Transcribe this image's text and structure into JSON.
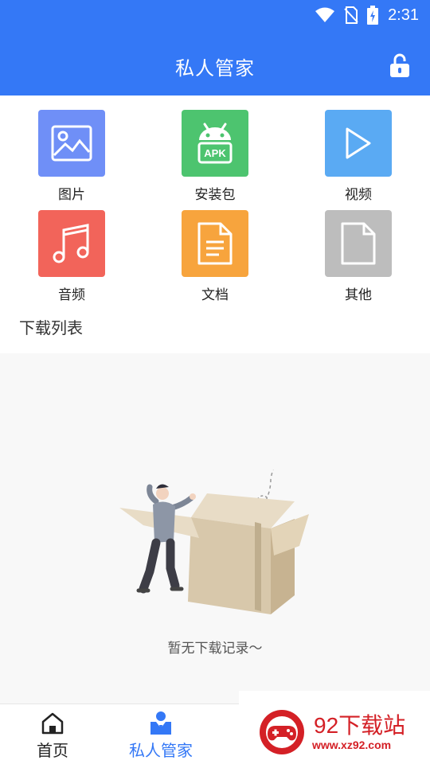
{
  "status_bar": {
    "time": "2:31"
  },
  "header": {
    "title": "私人管家"
  },
  "categories": [
    {
      "label": "图片",
      "icon": "image-icon",
      "color": "#6f8ff7"
    },
    {
      "label": "安装包",
      "icon": "apk-icon",
      "color": "#4dc46f"
    },
    {
      "label": "视频",
      "icon": "play-icon",
      "color": "#5aaaf3"
    },
    {
      "label": "音频",
      "icon": "music-icon",
      "color": "#f2645a"
    },
    {
      "label": "文档",
      "icon": "document-icon",
      "color": "#f7a43d"
    },
    {
      "label": "其他",
      "icon": "file-icon",
      "color": "#bdbdbd"
    }
  ],
  "apk_text": "APK",
  "downloads": {
    "section_title": "下载列表",
    "empty_text": "暂无下载记录～"
  },
  "tabbar": {
    "tabs": [
      {
        "label": "首页",
        "icon": "home-icon",
        "active": false
      },
      {
        "label": "私人管家",
        "icon": "butler-icon",
        "active": true
      }
    ],
    "active_color": "#3478f6",
    "inactive_color": "#222222"
  },
  "watermark": {
    "text": "92下载站",
    "url": "www.xz92.com"
  }
}
